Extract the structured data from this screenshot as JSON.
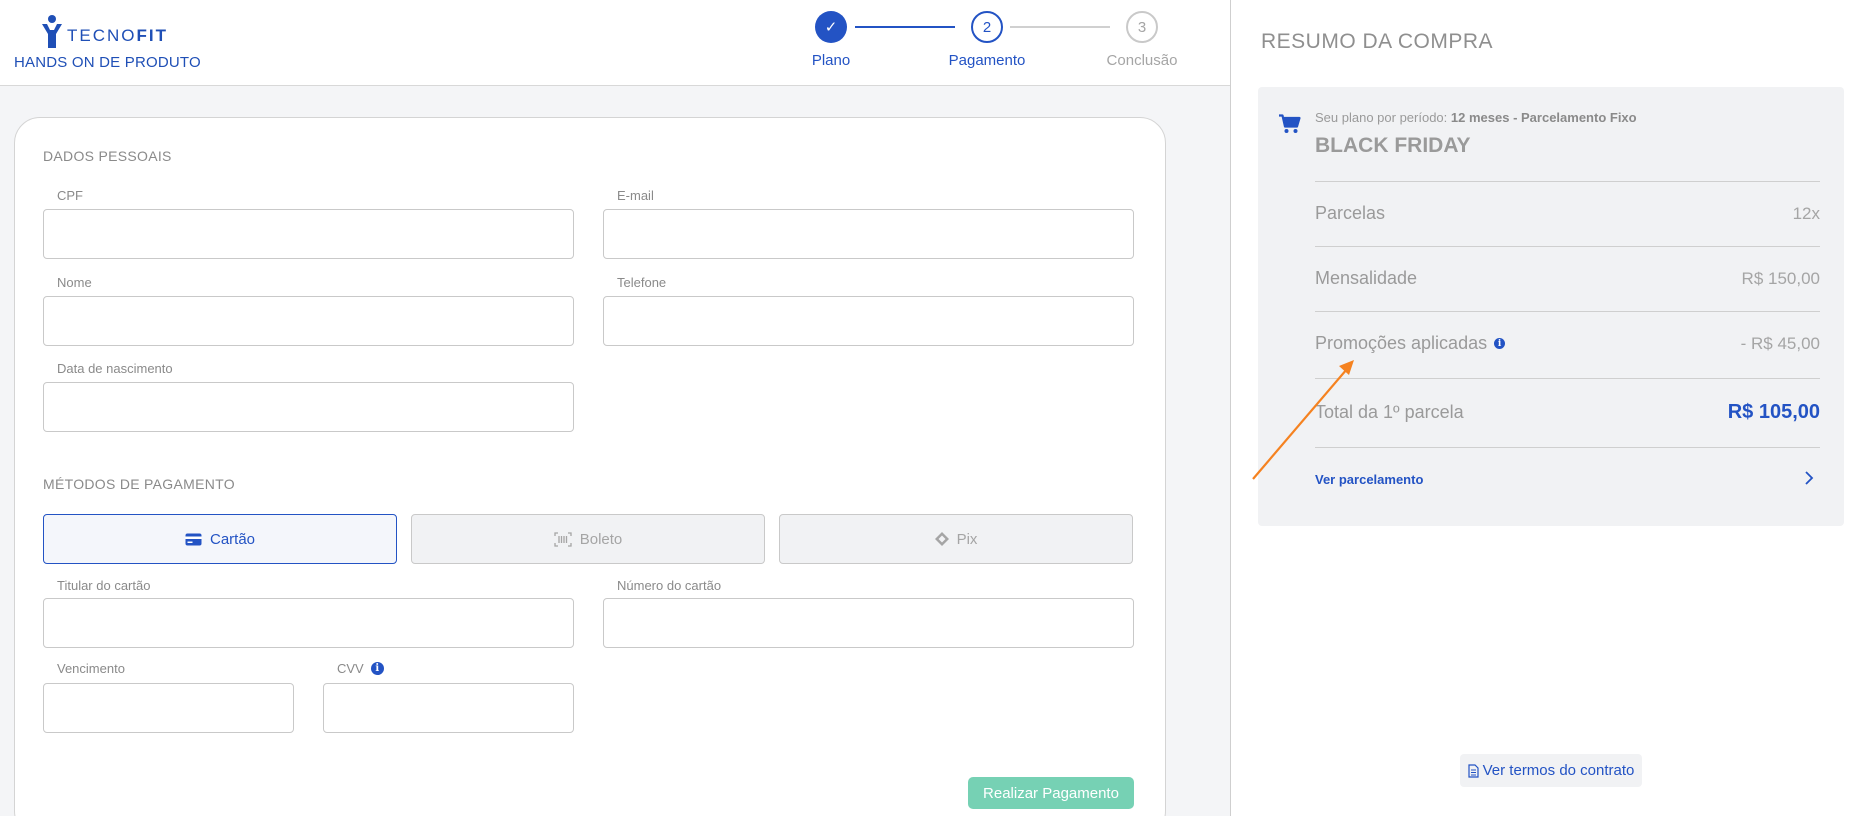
{
  "brand": {
    "logo_name": "TECNO",
    "logo_bold": "FIT",
    "subtitle": "HANDS ON DE PRODUTO"
  },
  "stepper": {
    "steps": [
      {
        "number": "✓",
        "label": "Plano",
        "state": "done"
      },
      {
        "number": "2",
        "label": "Pagamento",
        "state": "current"
      },
      {
        "number": "3",
        "label": "Conclusão",
        "state": "pending"
      }
    ]
  },
  "form": {
    "personal_title": "DADOS PESSOAIS",
    "fields": {
      "cpf": {
        "label": "CPF",
        "value": ""
      },
      "email": {
        "label": "E-mail",
        "value": ""
      },
      "nome": {
        "label": "Nome",
        "value": ""
      },
      "telefone": {
        "label": "Telefone",
        "value": ""
      },
      "nascimento": {
        "label": "Data de nascimento",
        "value": ""
      },
      "titular": {
        "label": "Titular do cartão",
        "value": ""
      },
      "numero": {
        "label": "Número do cartão",
        "value": ""
      },
      "vencimento": {
        "label": "Vencimento",
        "value": ""
      },
      "cvv": {
        "label": "CVV",
        "value": ""
      }
    },
    "payment_title": "MÉTODOS DE PAGAMENTO",
    "payment_methods": [
      {
        "label": "Cartão",
        "icon": "credit-card-icon",
        "selected": true
      },
      {
        "label": "Boleto",
        "icon": "barcode-icon",
        "selected": false
      },
      {
        "label": "Pix",
        "icon": "pix-icon",
        "selected": false
      }
    ],
    "submit_label": "Realizar Pagamento"
  },
  "summary": {
    "title": "RESUMO DA COMPRA",
    "plan_prefix": "Seu plano por período:",
    "plan_period": "12 meses - Parcelamento Fixo",
    "plan_name": "BLACK FRIDAY",
    "rows": {
      "parcelas": {
        "label": "Parcelas",
        "value": "12x"
      },
      "mensalidade": {
        "label": "Mensalidade",
        "value": "R$ 150,00"
      },
      "promocoes": {
        "label": "Promoções aplicadas",
        "value": "- R$ 45,00"
      },
      "total": {
        "label": "Total da 1º parcela",
        "value": "R$ 105,00"
      }
    },
    "ver_parcelamento": "Ver parcelamento",
    "termos_label": "Ver termos do contrato"
  },
  "colors": {
    "primary": "#2353c4",
    "success": "#76d1b4",
    "annotation": "#f58220"
  },
  "info_glyph": "i"
}
